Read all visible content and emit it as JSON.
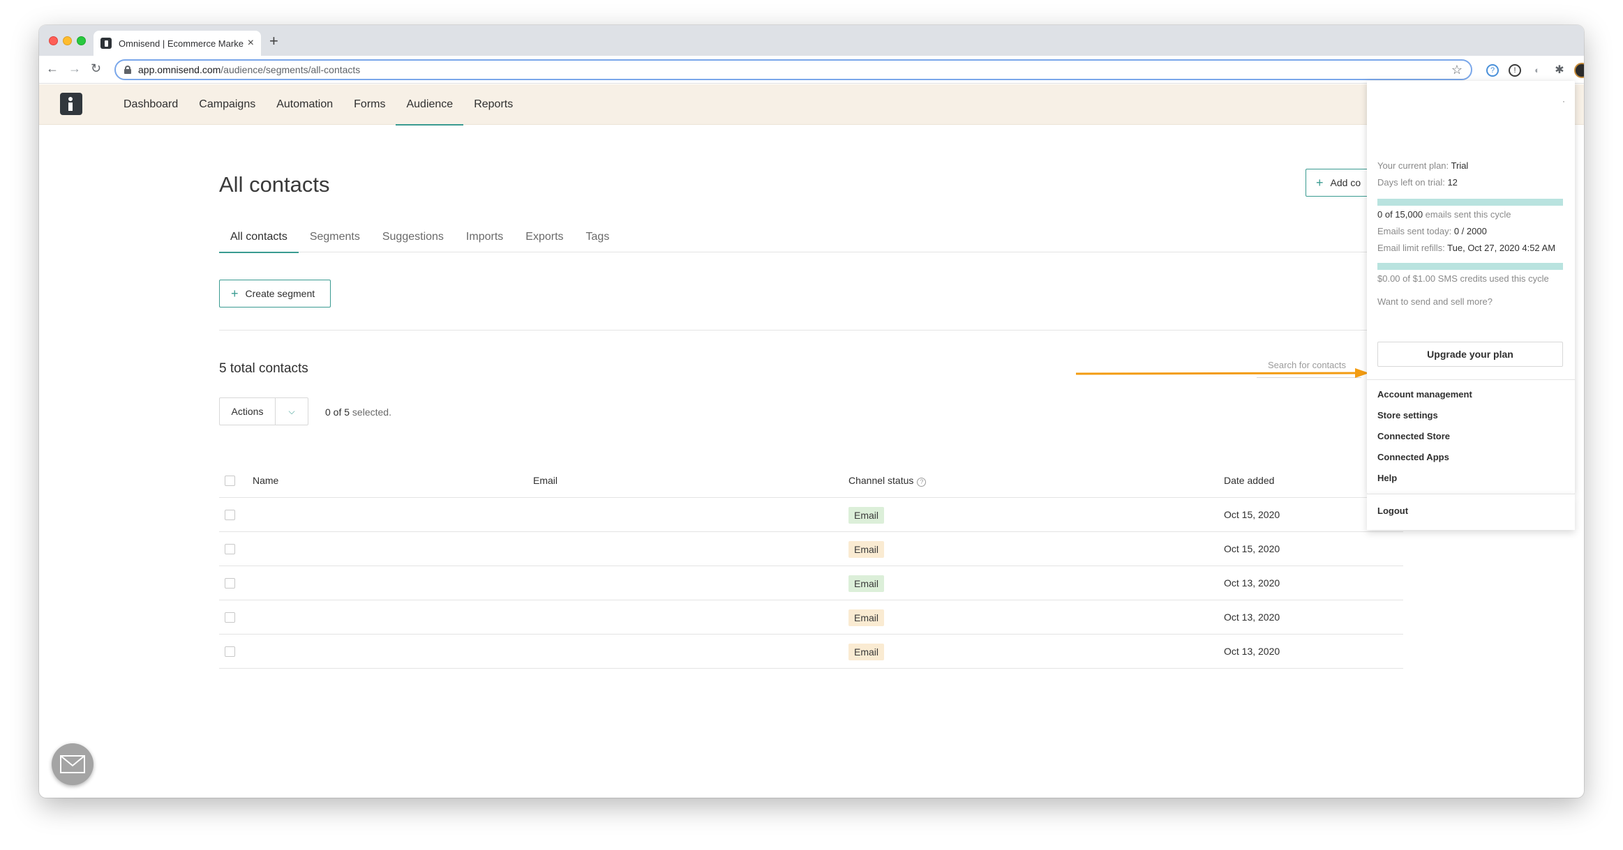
{
  "browser": {
    "tab_title": "Omnisend | Ecommerce Marke",
    "tab_close": "×",
    "new_tab": "+",
    "url_host": "app.omnisend.com",
    "url_path": "/audience/segments/all-contacts"
  },
  "nav": {
    "items": [
      {
        "label": "Dashboard"
      },
      {
        "label": "Campaigns"
      },
      {
        "label": "Automation"
      },
      {
        "label": "Forms"
      },
      {
        "label": "Audience"
      },
      {
        "label": "Reports"
      }
    ],
    "active": "Audience"
  },
  "page": {
    "title": "All contacts",
    "add_contacts_label": "Add co",
    "tabs": [
      {
        "label": "All contacts"
      },
      {
        "label": "Segments"
      },
      {
        "label": "Suggestions"
      },
      {
        "label": "Imports"
      },
      {
        "label": "Exports"
      },
      {
        "label": "Tags"
      }
    ],
    "create_segment_label": "Create segment",
    "total_contacts": "5 total contacts",
    "search_placeholder": "Search for contacts",
    "actions_label": "Actions",
    "selection_prefix": "0 of 5",
    "selection_suffix": " selected."
  },
  "table": {
    "headers": {
      "name": "Name",
      "email": "Email",
      "channel": "Channel status",
      "date": "Date added"
    },
    "info_glyph": "?",
    "rows": [
      {
        "name": "",
        "email": "",
        "channel": "Email",
        "status": "green",
        "date": "Oct 15, 2020"
      },
      {
        "name": "",
        "email": "",
        "channel": "Email",
        "status": "orange",
        "date": "Oct 15, 2020"
      },
      {
        "name": "",
        "email": "",
        "channel": "Email",
        "status": "green",
        "date": "Oct 13, 2020"
      },
      {
        "name": "",
        "email": "",
        "channel": "Email",
        "status": "orange",
        "date": "Oct 13, 2020"
      },
      {
        "name": "",
        "email": "",
        "channel": "Email",
        "status": "orange",
        "date": "Oct 13, 2020"
      }
    ]
  },
  "account_panel": {
    "dot": "·",
    "plan_label": "Your current plan: ",
    "plan_value": "Trial",
    "days_label": "Days left on trial: ",
    "days_value": "12",
    "emails_cycle_value": "0 of 15,000",
    "emails_cycle_suffix": " emails sent this cycle",
    "emails_today_label": "Emails sent today: ",
    "emails_today_value": "0 / 2000",
    "refill_label": "Email limit refills: ",
    "refill_value": "Tue, Oct 27, 2020 4:52 AM",
    "sms_text": "$0.00 of $1.00 SMS credits used this cycle",
    "upsell_text": "Want to send and sell more?",
    "upgrade_label": "Upgrade your plan",
    "menu": [
      {
        "label": "Account management"
      },
      {
        "label": "Store settings"
      },
      {
        "label": "Connected Store"
      },
      {
        "label": "Connected Apps"
      },
      {
        "label": "Help"
      }
    ],
    "logout_label": "Logout"
  },
  "icons": {
    "back": "←",
    "forward": "→",
    "reload": "↻",
    "star": "☆",
    "plus": "+",
    "chevron_down": "⌵",
    "extensions": "✱"
  },
  "colors": {
    "accent": "#3a9b91",
    "header_bg": "#f7f0e6",
    "badge_green": "#dcefd9",
    "badge_orange": "#faebd2",
    "arrow": "#f39c12",
    "usage_bar": "#b9e3df"
  }
}
